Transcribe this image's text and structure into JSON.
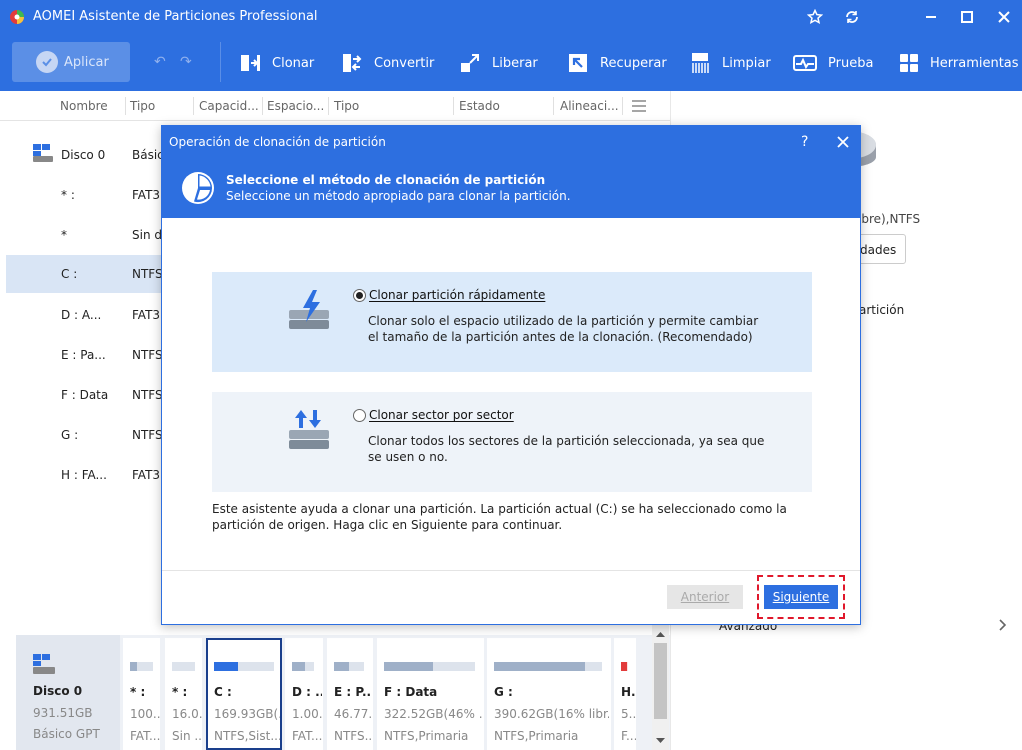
{
  "app": {
    "title": "AOMEI Asistente de Particiones Professional",
    "colors": {
      "accent": "#2d6fe0",
      "selected_row": "#d9e5f5",
      "highlight": "#e0182b"
    }
  },
  "toolbar": {
    "apply_label": "Aplicar",
    "tools": [
      "Clonar",
      "Convertir",
      "Liberar",
      "Recuperar",
      "Limpiar",
      "Prueba",
      "Herramientas"
    ]
  },
  "list": {
    "columns": [
      "Nombre",
      "Tipo",
      "Capacid...",
      "Espacio...",
      "Tipo",
      "Estado",
      "Alineaci..."
    ],
    "rows": [
      {
        "name": "Disco 0",
        "type": "Básic"
      },
      {
        "name": "* :",
        "type": "FAT3"
      },
      {
        "name": "*",
        "type": "Sin d"
      },
      {
        "name": "C :",
        "type": "NTFS"
      },
      {
        "name": "D : A...",
        "type": "FAT3"
      },
      {
        "name": "E : Pa...",
        "type": "NTFS"
      },
      {
        "name": "F : Data",
        "type": "NTFS"
      },
      {
        "name": "G :",
        "type": "NTFS"
      },
      {
        "name": "H : FA...",
        "type": "FAT3"
      }
    ]
  },
  "right_panel": {
    "fs_text": "ibre),NTFS",
    "props_button": "dades",
    "link_partition": "artición",
    "advanced": "Avanzado"
  },
  "disk_map": {
    "disk": {
      "name": "Disco 0",
      "size": "931.51GB",
      "type": "Básico GPT"
    },
    "partitions": [
      {
        "label": "* :",
        "line1": "100...",
        "line2": "FAT...",
        "used": 0.3
      },
      {
        "label": "* :",
        "line1": "16.0...",
        "line2": "Sin ...",
        "used": 0.0
      },
      {
        "label": "C :",
        "line1": "169.93GB(...",
        "line2": "NTFS,Sist...",
        "used": 0.4
      },
      {
        "label": "D : ...",
        "line1": "1.00...",
        "line2": "FAT...",
        "used": 0.6
      },
      {
        "label": "E : P...",
        "line1": "46.77...",
        "line2": "NTFS...",
        "used": 0.5
      },
      {
        "label": "F : Data",
        "line1": "322.52GB(46% ...",
        "line2": "NTFS,Primaria",
        "used": 0.54
      },
      {
        "label": "G :",
        "line1": "390.62GB(16% libr...",
        "line2": "NTFS,Primaria",
        "used": 0.84
      },
      {
        "label": "H...",
        "line1": "5...",
        "line2": "F...",
        "used": 0.9
      }
    ]
  },
  "dialog": {
    "title": "Operación de clonación de partición",
    "help": "?",
    "header_title": "Seleccione el método de clonación de partición",
    "header_subtitle": "Seleccione un método apropiado para clonar la partición.",
    "option_fast": {
      "label": "Clonar partición rápidamente",
      "line1": "Clonar solo el espacio utilizado de la partición y permite cambiar",
      "line2": "el tamaño de la partición antes de la clonación. (Recomendado)",
      "selected": true
    },
    "option_sector": {
      "label": " Clonar sector por sector",
      "line1": "Clonar todos los sectores de la partición seleccionada, ya sea que",
      "line2": "se usen o no.",
      "selected": false
    },
    "info_line1": "Este asistente ayuda a clonar una partición. La partición actual (C:) se ha seleccionado como la",
    "info_line2": "partición de origen. Haga clic en Siguiente para continuar.",
    "btn_back": "Anterior",
    "btn_next": "Siguiente"
  }
}
